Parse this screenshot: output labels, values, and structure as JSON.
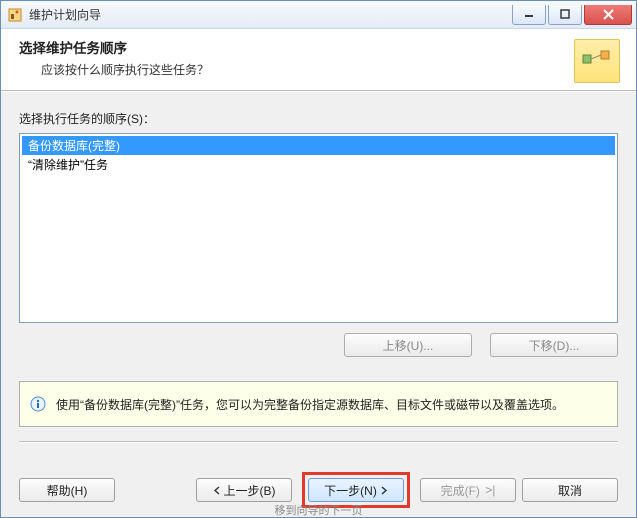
{
  "titlebar": {
    "title": "维护计划向导"
  },
  "header": {
    "title": "选择维护任务顺序",
    "subtitle": "应该按什么顺序执行这些任务？"
  },
  "order": {
    "label": "选择执行任务的顺序(S)：",
    "items": [
      {
        "label": "备份数据库(完整)",
        "selected": true
      },
      {
        "label": "“清除维护”任务",
        "selected": false
      }
    ]
  },
  "move_buttons": {
    "up": "上移(U)...",
    "down": "下移(D)..."
  },
  "info": {
    "text": "使用“备份数据库(完整)”任务，您可以为完整备份指定源数据库、目标文件或磁带以及覆盖选项。"
  },
  "footer": {
    "help": "帮助(H)",
    "back": "上一步(B)",
    "next": "下一步(N)",
    "finish": "完成(F)",
    "cancel": "取消"
  },
  "bottom_hint": "移到向导的下一页"
}
